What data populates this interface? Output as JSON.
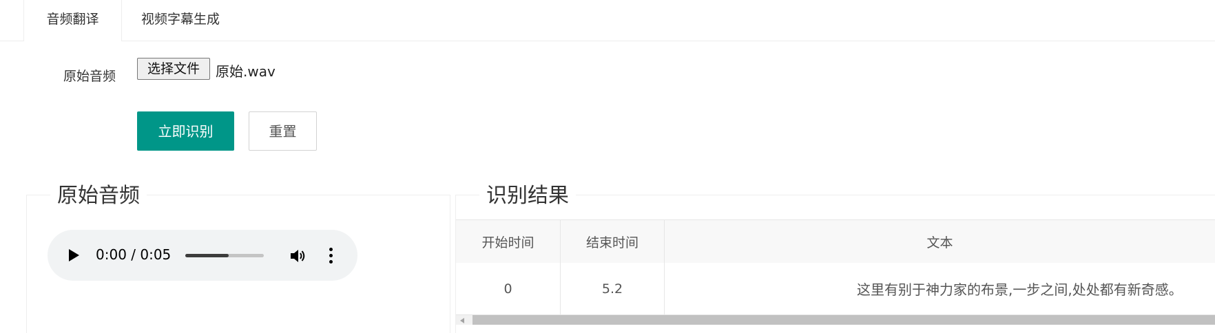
{
  "tabs": [
    {
      "label": "音频翻译",
      "active": true
    },
    {
      "label": "视频字幕生成",
      "active": false
    }
  ],
  "form": {
    "audio_label": "原始音频",
    "file_button": "选择文件",
    "file_name": "原始.wav",
    "recognize_button": "立即识别",
    "reset_button": "重置"
  },
  "audio_panel": {
    "title": "原始音频",
    "player": {
      "time": "0:00 / 0:05",
      "progress": 0.55,
      "icons": [
        "play-icon",
        "volume-icon",
        "more-options-icon"
      ]
    }
  },
  "result_panel": {
    "title": "识别结果",
    "columns": [
      "开始时间",
      "结束时间",
      "文本"
    ],
    "rows": [
      {
        "start": "0",
        "end": "5.2",
        "text": "这里有别于神力家的布景,一步之间,处处都有新奇感。"
      }
    ]
  },
  "colors": {
    "primary": "#009688",
    "header_bg": "#f8f8f8",
    "player_bg": "#f1f3f4"
  }
}
